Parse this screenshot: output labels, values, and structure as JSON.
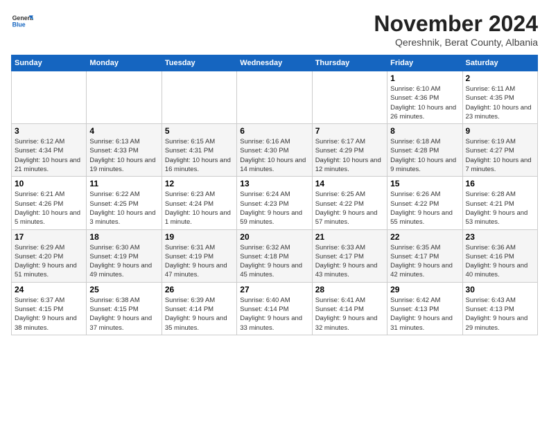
{
  "logo": {
    "general": "General",
    "blue": "Blue"
  },
  "title": "November 2024",
  "subtitle": "Qereshnik, Berat County, Albania",
  "days_of_week": [
    "Sunday",
    "Monday",
    "Tuesday",
    "Wednesday",
    "Thursday",
    "Friday",
    "Saturday"
  ],
  "weeks": [
    [
      {
        "day": "",
        "info": ""
      },
      {
        "day": "",
        "info": ""
      },
      {
        "day": "",
        "info": ""
      },
      {
        "day": "",
        "info": ""
      },
      {
        "day": "",
        "info": ""
      },
      {
        "day": "1",
        "info": "Sunrise: 6:10 AM\nSunset: 4:36 PM\nDaylight: 10 hours and 26 minutes."
      },
      {
        "day": "2",
        "info": "Sunrise: 6:11 AM\nSunset: 4:35 PM\nDaylight: 10 hours and 23 minutes."
      }
    ],
    [
      {
        "day": "3",
        "info": "Sunrise: 6:12 AM\nSunset: 4:34 PM\nDaylight: 10 hours and 21 minutes."
      },
      {
        "day": "4",
        "info": "Sunrise: 6:13 AM\nSunset: 4:33 PM\nDaylight: 10 hours and 19 minutes."
      },
      {
        "day": "5",
        "info": "Sunrise: 6:15 AM\nSunset: 4:31 PM\nDaylight: 10 hours and 16 minutes."
      },
      {
        "day": "6",
        "info": "Sunrise: 6:16 AM\nSunset: 4:30 PM\nDaylight: 10 hours and 14 minutes."
      },
      {
        "day": "7",
        "info": "Sunrise: 6:17 AM\nSunset: 4:29 PM\nDaylight: 10 hours and 12 minutes."
      },
      {
        "day": "8",
        "info": "Sunrise: 6:18 AM\nSunset: 4:28 PM\nDaylight: 10 hours and 9 minutes."
      },
      {
        "day": "9",
        "info": "Sunrise: 6:19 AM\nSunset: 4:27 PM\nDaylight: 10 hours and 7 minutes."
      }
    ],
    [
      {
        "day": "10",
        "info": "Sunrise: 6:21 AM\nSunset: 4:26 PM\nDaylight: 10 hours and 5 minutes."
      },
      {
        "day": "11",
        "info": "Sunrise: 6:22 AM\nSunset: 4:25 PM\nDaylight: 10 hours and 3 minutes."
      },
      {
        "day": "12",
        "info": "Sunrise: 6:23 AM\nSunset: 4:24 PM\nDaylight: 10 hours and 1 minute."
      },
      {
        "day": "13",
        "info": "Sunrise: 6:24 AM\nSunset: 4:23 PM\nDaylight: 9 hours and 59 minutes."
      },
      {
        "day": "14",
        "info": "Sunrise: 6:25 AM\nSunset: 4:22 PM\nDaylight: 9 hours and 57 minutes."
      },
      {
        "day": "15",
        "info": "Sunrise: 6:26 AM\nSunset: 4:22 PM\nDaylight: 9 hours and 55 minutes."
      },
      {
        "day": "16",
        "info": "Sunrise: 6:28 AM\nSunset: 4:21 PM\nDaylight: 9 hours and 53 minutes."
      }
    ],
    [
      {
        "day": "17",
        "info": "Sunrise: 6:29 AM\nSunset: 4:20 PM\nDaylight: 9 hours and 51 minutes."
      },
      {
        "day": "18",
        "info": "Sunrise: 6:30 AM\nSunset: 4:19 PM\nDaylight: 9 hours and 49 minutes."
      },
      {
        "day": "19",
        "info": "Sunrise: 6:31 AM\nSunset: 4:19 PM\nDaylight: 9 hours and 47 minutes."
      },
      {
        "day": "20",
        "info": "Sunrise: 6:32 AM\nSunset: 4:18 PM\nDaylight: 9 hours and 45 minutes."
      },
      {
        "day": "21",
        "info": "Sunrise: 6:33 AM\nSunset: 4:17 PM\nDaylight: 9 hours and 43 minutes."
      },
      {
        "day": "22",
        "info": "Sunrise: 6:35 AM\nSunset: 4:17 PM\nDaylight: 9 hours and 42 minutes."
      },
      {
        "day": "23",
        "info": "Sunrise: 6:36 AM\nSunset: 4:16 PM\nDaylight: 9 hours and 40 minutes."
      }
    ],
    [
      {
        "day": "24",
        "info": "Sunrise: 6:37 AM\nSunset: 4:15 PM\nDaylight: 9 hours and 38 minutes."
      },
      {
        "day": "25",
        "info": "Sunrise: 6:38 AM\nSunset: 4:15 PM\nDaylight: 9 hours and 37 minutes."
      },
      {
        "day": "26",
        "info": "Sunrise: 6:39 AM\nSunset: 4:14 PM\nDaylight: 9 hours and 35 minutes."
      },
      {
        "day": "27",
        "info": "Sunrise: 6:40 AM\nSunset: 4:14 PM\nDaylight: 9 hours and 33 minutes."
      },
      {
        "day": "28",
        "info": "Sunrise: 6:41 AM\nSunset: 4:14 PM\nDaylight: 9 hours and 32 minutes."
      },
      {
        "day": "29",
        "info": "Sunrise: 6:42 AM\nSunset: 4:13 PM\nDaylight: 9 hours and 31 minutes."
      },
      {
        "day": "30",
        "info": "Sunrise: 6:43 AM\nSunset: 4:13 PM\nDaylight: 9 hours and 29 minutes."
      }
    ]
  ]
}
